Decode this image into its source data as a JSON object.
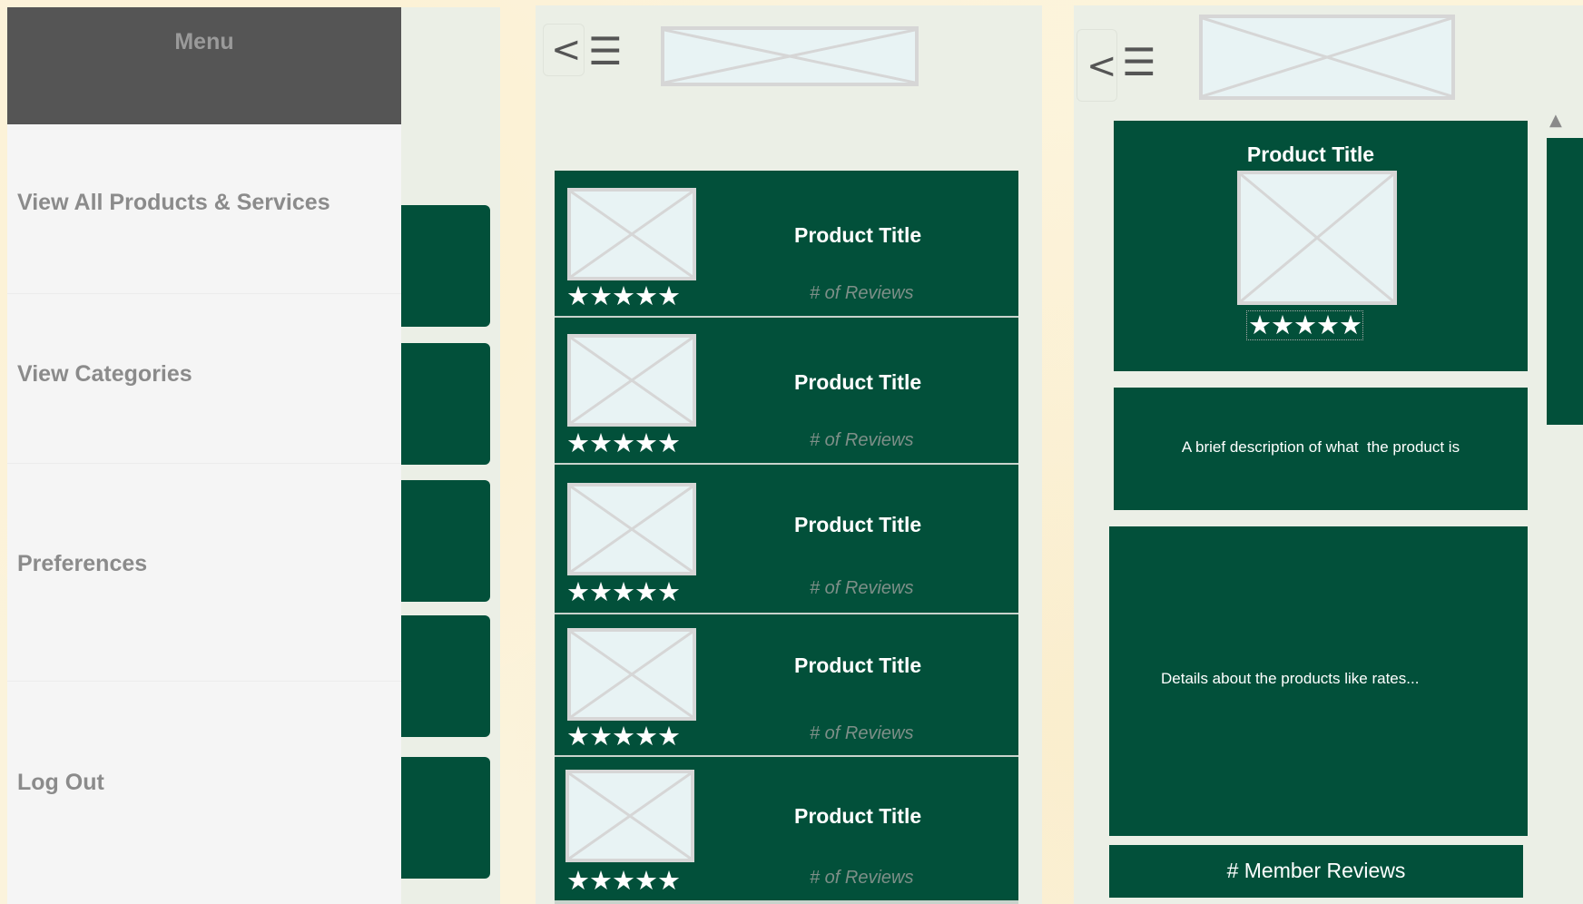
{
  "menu": {
    "header": "Menu",
    "items": [
      {
        "label": "View All Products & Services"
      },
      {
        "label": "View Categories"
      },
      {
        "label": "Preferences"
      },
      {
        "label": "Log Out"
      }
    ]
  },
  "list_screen": {
    "back_icon": "<",
    "menu_icon": "☰",
    "products": [
      {
        "title": "Product Title",
        "reviews": "# of Reviews",
        "stars": "★★★★★",
        "rating": 5
      },
      {
        "title": "Product Title",
        "reviews": "# of Reviews",
        "stars": "★★★★★",
        "rating": 5
      },
      {
        "title": "Product Title",
        "reviews": "# of Reviews",
        "stars": "★★★★★",
        "rating": 5
      },
      {
        "title": "Product Title",
        "reviews": "# of Reviews",
        "stars": "★★★★★",
        "rating": 5
      },
      {
        "title": "Product Title",
        "reviews": "# of Reviews",
        "stars": "★★★★★",
        "rating": 5
      }
    ]
  },
  "detail_screen": {
    "back_icon": "<",
    "menu_icon": "☰",
    "product_title": "Product Title",
    "stars": "★★★★★",
    "rating": 5,
    "description": "A brief description of what  the product is",
    "details": "Details about the products like rates...",
    "member_reviews": "# Member Reviews",
    "scroll_up_icon": "▲",
    "scroll_position": 0
  },
  "colors": {
    "primary_green": "#02503a",
    "menu_header": "#555555",
    "menu_bg": "#f5f5f5",
    "screen_bg": "#ebefe6",
    "placeholder_bg": "#e8f3f4"
  },
  "icons": [
    "back-icon",
    "hamburger-menu-icon",
    "image-placeholder-icon",
    "star-icon",
    "scroll-up-icon"
  ]
}
